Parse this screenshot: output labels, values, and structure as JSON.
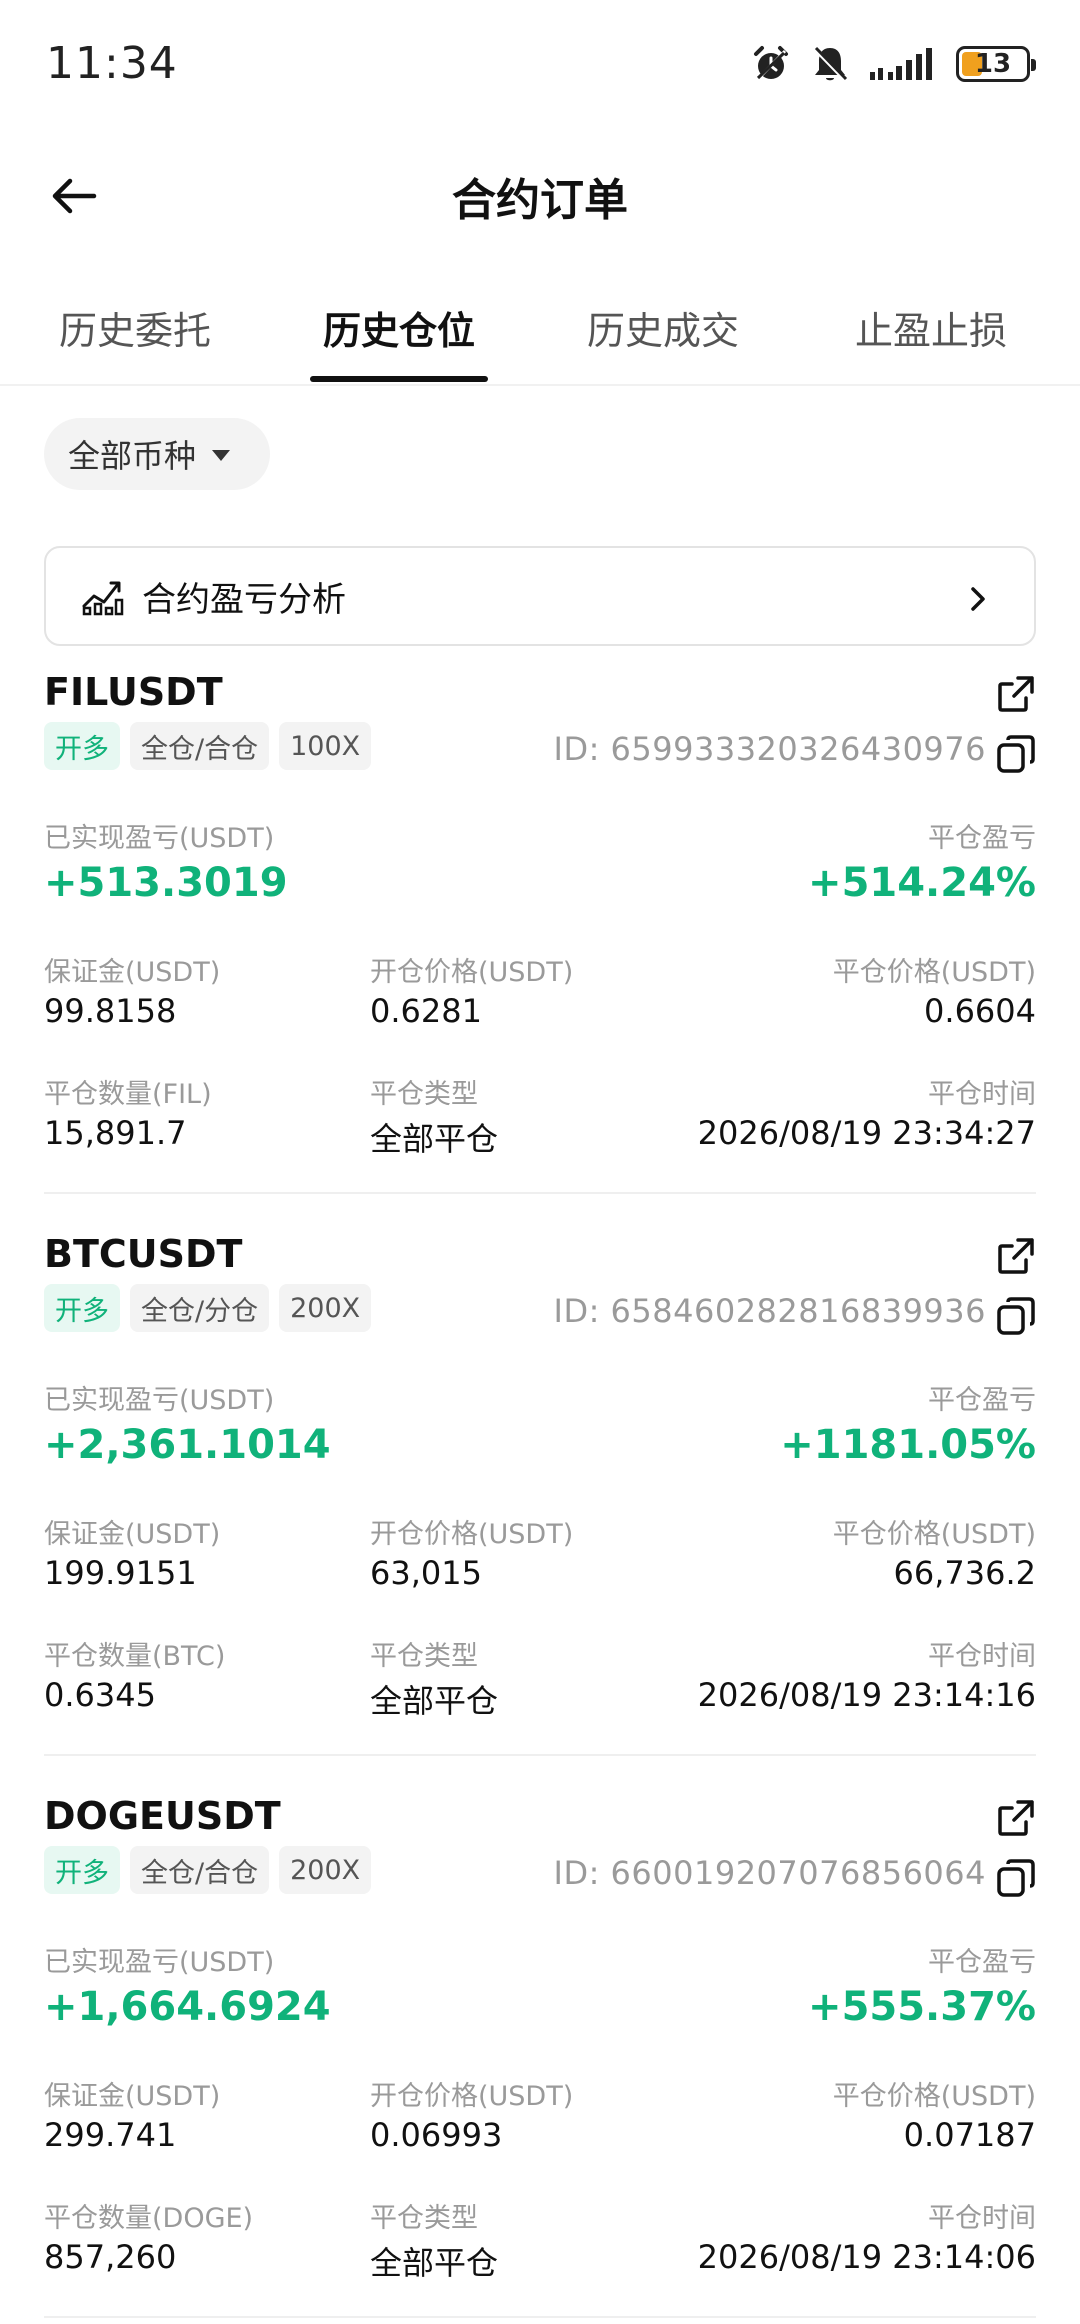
{
  "status_bar": {
    "time": "11:34",
    "battery": "13",
    "icons": [
      "alarm-icon",
      "bell-off-icon",
      "signal-icon",
      "battery-icon"
    ]
  },
  "header": {
    "title": "合约订单"
  },
  "tabs": [
    {
      "label": "历史委托",
      "active": false
    },
    {
      "label": "历史仓位",
      "active": true
    },
    {
      "label": "历史成交",
      "active": false
    },
    {
      "label": "止盈止损",
      "active": false
    }
  ],
  "filter": {
    "label": "全部币种"
  },
  "analysis": {
    "label": "合约盈亏分析"
  },
  "colors": {
    "profit_green": "#10b27a",
    "tag_green_bg": "#e7f8f2",
    "battery_orange": "#f0a01e"
  },
  "labels": {
    "realized_pnl": "已实现盈亏(USDT)",
    "close_pnl": "平仓盈亏",
    "margin": "保证金(USDT)",
    "open_price": "开仓价格(USDT)",
    "close_price": "平仓价格(USDT)",
    "close_type": "平仓类型",
    "close_time": "平仓时间"
  },
  "orders": [
    {
      "symbol": "FILUSDT",
      "direction": "开多",
      "margin_mode": "全仓/合仓",
      "leverage": "100X",
      "id": "ID:  659933320326430976",
      "realized_pnl": "+513.3019",
      "close_pnl_pct": "+514.24%",
      "margin": "99.8158",
      "open_price": "0.6281",
      "close_price": "0.6604",
      "close_qty_label": "平仓数量(FIL)",
      "close_qty": "15,891.7",
      "close_type": "全部平仓",
      "close_time": "2026/08/19 23:34:27"
    },
    {
      "symbol": "BTCUSDT",
      "direction": "开多",
      "margin_mode": "全仓/分仓",
      "leverage": "200X",
      "id": "ID:  658460282816839936",
      "realized_pnl": "+2,361.1014",
      "close_pnl_pct": "+1181.05%",
      "margin": "199.9151",
      "open_price": "63,015",
      "close_price": "66,736.2",
      "close_qty_label": "平仓数量(BTC)",
      "close_qty": "0.6345",
      "close_type": "全部平仓",
      "close_time": "2026/08/19 23:14:16"
    },
    {
      "symbol": "DOGEUSDT",
      "direction": "开多",
      "margin_mode": "全仓/合仓",
      "leverage": "200X",
      "id": "ID:  660019207076856064",
      "realized_pnl": "+1,664.6924",
      "close_pnl_pct": "+555.37%",
      "margin": "299.741",
      "open_price": "0.06993",
      "close_price": "0.07187",
      "close_qty_label": "平仓数量(DOGE)",
      "close_qty": "857,260",
      "close_type": "全部平仓",
      "close_time": "2026/08/19 23:14:06"
    }
  ]
}
